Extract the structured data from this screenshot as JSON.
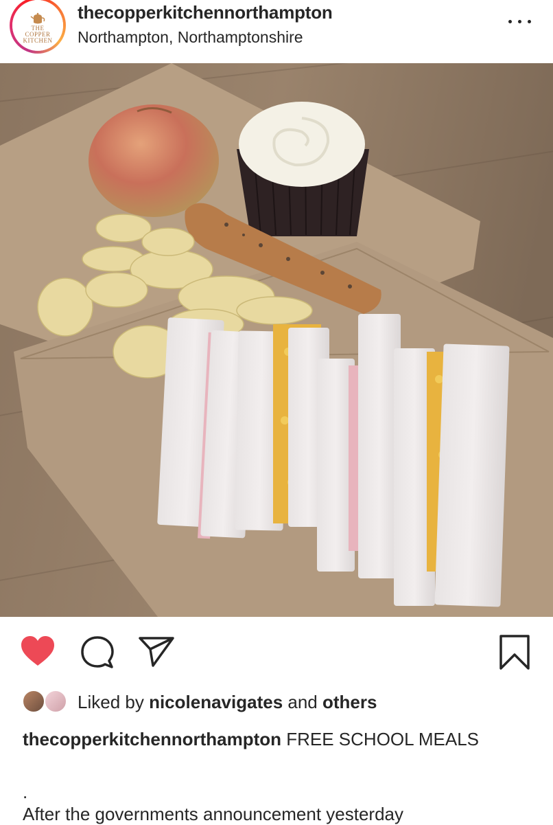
{
  "post": {
    "username": "thecopperkitchennorthampton",
    "location": "Northampton, Northamptonshire",
    "avatar_logo_line1": "COPPER",
    "avatar_logo_line2": "KITCHEN",
    "avatar_logo_line0": "THE"
  },
  "photo": {
    "subject": "Packed lunch on brown paper: apple, cupcake, cheese straw, crisps, ham and cheese sandwiches"
  },
  "actions": {
    "like_icon": "heart-icon",
    "comment_icon": "comment-bubble-icon",
    "share_icon": "paper-plane-icon",
    "save_icon": "bookmark-icon",
    "liked_color": "#ed4956"
  },
  "likes": {
    "prefix": "Liked by ",
    "user": "nicolenavigates",
    "middle": " and ",
    "others": "others"
  },
  "caption": {
    "username": "thecopperkitchennorthampton",
    "text": " FREE SCHOOL MEALS",
    "separator": ".",
    "continued": "After the governments announcement yesterday"
  }
}
